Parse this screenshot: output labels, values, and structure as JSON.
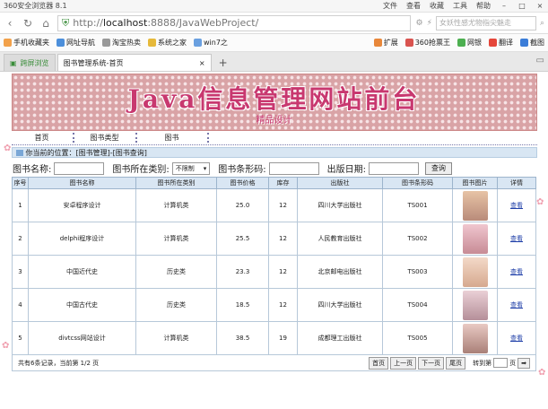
{
  "browser": {
    "title": "360安全浏览器 8.1",
    "menus": [
      "文件",
      "查看",
      "收藏",
      "工具",
      "帮助"
    ],
    "url_prefix": "http://",
    "url_host": "localhost",
    "url_path": ":8888/JavaWebProject/",
    "search_placeholder": "女妖性感尤物指尖魅走",
    "bookmarks": [
      "手机收藏夹",
      "网址导航",
      "淘宝热卖",
      "系统之家",
      "win7之"
    ],
    "ext_items": [
      "扩展",
      "360抢票王",
      "网银",
      "翻译",
      "截图"
    ],
    "tabs": [
      {
        "label": "跨屏浏览"
      },
      {
        "label": "图书管理系统-首页"
      }
    ]
  },
  "banner": {
    "title": "Java信息管理网站前台",
    "subtitle": "精品设计"
  },
  "nav": [
    "首页",
    "图书类型",
    "图书"
  ],
  "location": "你当前的位置：[图书管理]-[图书查询]",
  "filters": {
    "name_label": "图书名称:",
    "type_label": "图书所在类别:",
    "type_value": "不限制",
    "barcode_label": "图书条形码:",
    "date_label": "出版日期:",
    "query_button": "查询"
  },
  "table": {
    "headers": [
      "序号",
      "图书名称",
      "图书所在类别",
      "图书价格",
      "库存",
      "出版社",
      "图书条形码",
      "图书图片",
      "详情"
    ],
    "rows": [
      {
        "no": "1",
        "name": "安卓程序设计",
        "type": "计算机类",
        "price": "25.0",
        "stock": "12",
        "publisher": "四川大学出版社",
        "barcode": "TS001",
        "detail": "查看"
      },
      {
        "no": "2",
        "name": "delphi程序设计",
        "type": "计算机类",
        "price": "25.5",
        "stock": "12",
        "publisher": "人民教育出版社",
        "barcode": "TS002",
        "detail": "查看"
      },
      {
        "no": "3",
        "name": "中国近代史",
        "type": "历史类",
        "price": "23.3",
        "stock": "12",
        "publisher": "北京邮电出版社",
        "barcode": "TS003",
        "detail": "查看"
      },
      {
        "no": "4",
        "name": "中国古代史",
        "type": "历史类",
        "price": "18.5",
        "stock": "12",
        "publisher": "四川大学出版社",
        "barcode": "TS004",
        "detail": "查看"
      },
      {
        "no": "5",
        "name": "divtcss网站设计",
        "type": "计算机类",
        "price": "38.5",
        "stock": "19",
        "publisher": "成都理工出版社",
        "barcode": "TS005",
        "detail": "查看"
      }
    ]
  },
  "pager": {
    "summary": "共有6条记录，当前第 1/2 页",
    "first": "首页",
    "prev": "上一页",
    "next": "下一页",
    "last": "尾页",
    "jump_label": "转到第",
    "page_unit": "页"
  },
  "colors": {
    "accent": "#c8386f",
    "header_bg": "#d9e6f3"
  }
}
